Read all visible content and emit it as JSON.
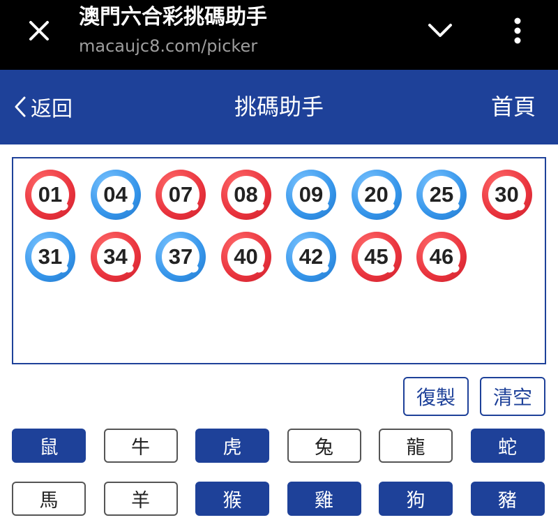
{
  "browser": {
    "title": "澳門六合彩挑碼助手",
    "url": "macaujc8.com/picker"
  },
  "header": {
    "back_label": "返回",
    "title": "挑碼助手",
    "home_label": "首頁",
    "color": "#1e4199"
  },
  "picked_numbers": [
    {
      "num": "01",
      "color": "red"
    },
    {
      "num": "04",
      "color": "blue"
    },
    {
      "num": "07",
      "color": "red"
    },
    {
      "num": "08",
      "color": "red"
    },
    {
      "num": "09",
      "color": "blue"
    },
    {
      "num": "20",
      "color": "blue"
    },
    {
      "num": "25",
      "color": "blue"
    },
    {
      "num": "30",
      "color": "red"
    },
    {
      "num": "31",
      "color": "blue"
    },
    {
      "num": "34",
      "color": "red"
    },
    {
      "num": "37",
      "color": "blue"
    },
    {
      "num": "40",
      "color": "red"
    },
    {
      "num": "42",
      "color": "blue"
    },
    {
      "num": "45",
      "color": "red"
    },
    {
      "num": "46",
      "color": "red"
    }
  ],
  "actions": {
    "copy_label": "復製",
    "clear_label": "清空"
  },
  "zodiac": [
    {
      "label": "鼠",
      "selected": true
    },
    {
      "label": "牛",
      "selected": false
    },
    {
      "label": "虎",
      "selected": true
    },
    {
      "label": "兔",
      "selected": false
    },
    {
      "label": "龍",
      "selected": false
    },
    {
      "label": "蛇",
      "selected": true
    },
    {
      "label": "馬",
      "selected": false
    },
    {
      "label": "羊",
      "selected": false
    },
    {
      "label": "猴",
      "selected": true
    },
    {
      "label": "雞",
      "selected": true
    },
    {
      "label": "狗",
      "selected": true
    },
    {
      "label": "豬",
      "selected": true
    }
  ],
  "icons": {
    "close": "close-icon",
    "collapse": "chevron-down-icon",
    "menu": "more-vertical-icon",
    "back": "chevron-left-icon"
  }
}
